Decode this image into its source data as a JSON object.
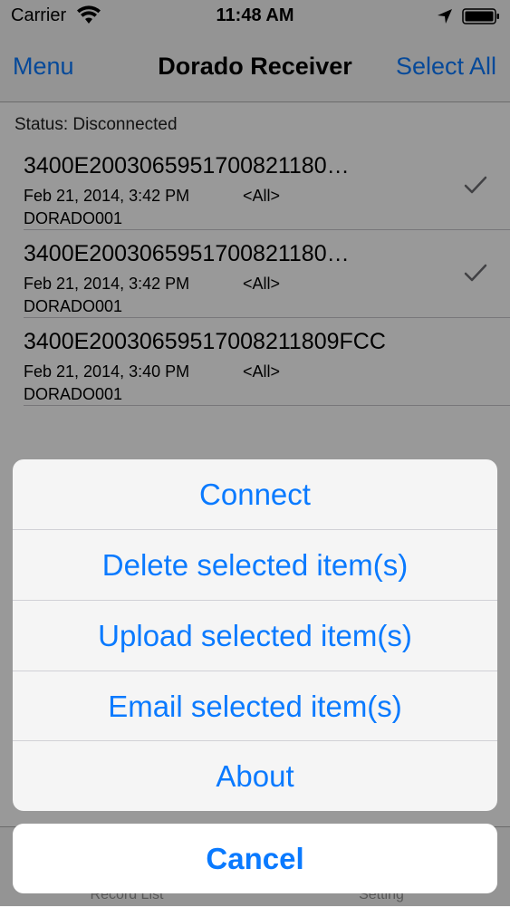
{
  "status_bar": {
    "carrier": "Carrier",
    "time": "11:48 AM"
  },
  "nav_bar": {
    "left_label": "Menu",
    "title": "Dorado Receiver",
    "right_label": "Select All"
  },
  "content": {
    "status": "Status: Disconnected",
    "records": [
      {
        "id": "3400E2003065951700821180…",
        "date": "Feb 21, 2014, 3:42 PM",
        "tag": "<All>",
        "device": "DORADO001",
        "selected": true
      },
      {
        "id": "3400E2003065951700821180…",
        "date": "Feb 21, 2014, 3:42 PM",
        "tag": "<All>",
        "device": "DORADO001",
        "selected": true
      },
      {
        "id": "3400E20030659517008211809FCC",
        "date": "Feb 21, 2014, 3:40 PM",
        "tag": "<All>",
        "device": "DORADO001",
        "selected": false
      }
    ]
  },
  "tab_bar": {
    "tabs": [
      {
        "label": "Record List"
      },
      {
        "label": "Setting"
      }
    ]
  },
  "action_sheet": {
    "buttons": [
      {
        "label": "Connect"
      },
      {
        "label": "Delete selected item(s)"
      },
      {
        "label": "Upload selected item(s)"
      },
      {
        "label": "Email selected item(s)"
      },
      {
        "label": "About"
      }
    ],
    "cancel_label": "Cancel"
  },
  "colors": {
    "accent": "#0a7aff",
    "dim_overlay": "rgba(0,0,0,0.40)"
  }
}
